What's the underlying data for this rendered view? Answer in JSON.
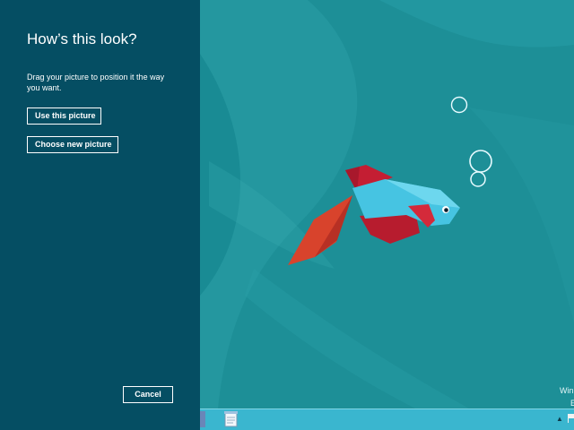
{
  "panel": {
    "title": "How’s this look?",
    "description": "Drag your picture to position it the way you want.",
    "use_picture_label": "Use this picture",
    "choose_picture_label": "Choose new picture",
    "cancel_label": "Cancel"
  },
  "desktop": {
    "watermark_text": "Win",
    "watermark_line2": "E"
  },
  "taskbar": {
    "app_icon": "notepad-icon",
    "tray_icons": [
      "chevron-up-icon",
      "flag-icon"
    ]
  },
  "colors": {
    "panel_bg": "#054e63",
    "wallpaper_bg": "#1e8e95",
    "taskbar_bg": "#3ab6cf",
    "fish_body": "#44c3e0",
    "fish_fins": "#c62032"
  }
}
